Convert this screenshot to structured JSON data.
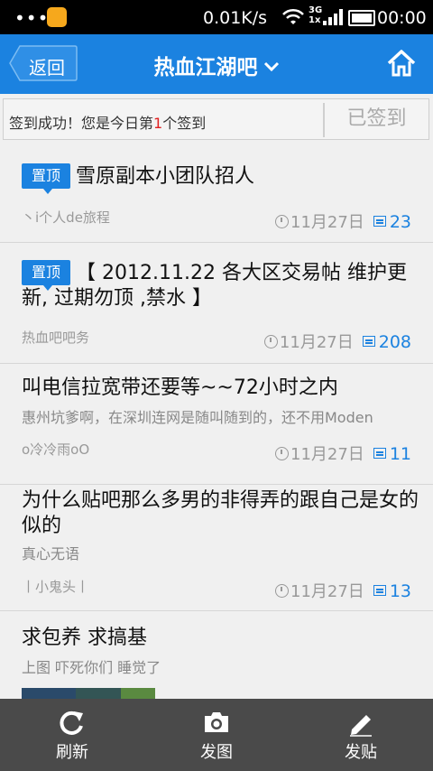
{
  "status_bar": {
    "dots": "•••",
    "speed": "0.01K/s",
    "network": "3G\n1x",
    "time": "00:00"
  },
  "header": {
    "back_label": "返回",
    "title": "热血江湖吧",
    "title_chevron": "⌄"
  },
  "signin": {
    "message_prefix": "签到成功！您是今日第",
    "rank": "1",
    "message_suffix": "个签到",
    "button_label": "已签到"
  },
  "pinned_badge": "置顶",
  "posts": [
    {
      "title": "雪原副本小团队招人",
      "excerpt": "",
      "author": "丶i个人de旅程",
      "date": "11月27日",
      "replies": "23",
      "pinned": true
    },
    {
      "title": "【 2012.11.22  各大区交易帖 维护更新, 过期勿顶 ,禁水 】",
      "excerpt": "",
      "author": "热血吧吧务",
      "date": "11月27日",
      "replies": "208",
      "pinned": true
    },
    {
      "title": "叫电信拉宽带还要等~~72小时之内",
      "excerpt": "惠州坑爹啊，在深圳连网是随叫随到的，还不用Moden",
      "author": "o冷冷雨oO",
      "date": "11月27日",
      "replies": "11",
      "pinned": false
    },
    {
      "title": "为什么贴吧那么多男的非得弄的跟自己是女的似的",
      "excerpt": "真心无语",
      "author": "丨小鬼头丨",
      "date": "11月27日",
      "replies": "13",
      "pinned": false
    },
    {
      "title": "求包养  求搞基",
      "excerpt": "上图 吓死你们 睡觉了",
      "author": "",
      "date": "",
      "replies": "",
      "pinned": false
    }
  ],
  "bottom_bar": {
    "refresh_label": "刷新",
    "photo_label": "发图",
    "post_label": "发贴"
  },
  "colors": {
    "accent": "#1b82e0",
    "statusbar": "#000000",
    "bottombar": "#4a4a4a",
    "background": "#f0f0f0"
  },
  "icons": [
    "qq-notification-icon",
    "wifi-icon",
    "signal-icon",
    "battery-icon",
    "back-arrow-icon",
    "home-icon",
    "clock-icon",
    "reply-icon",
    "refresh-icon",
    "camera-icon",
    "pen-icon"
  ]
}
